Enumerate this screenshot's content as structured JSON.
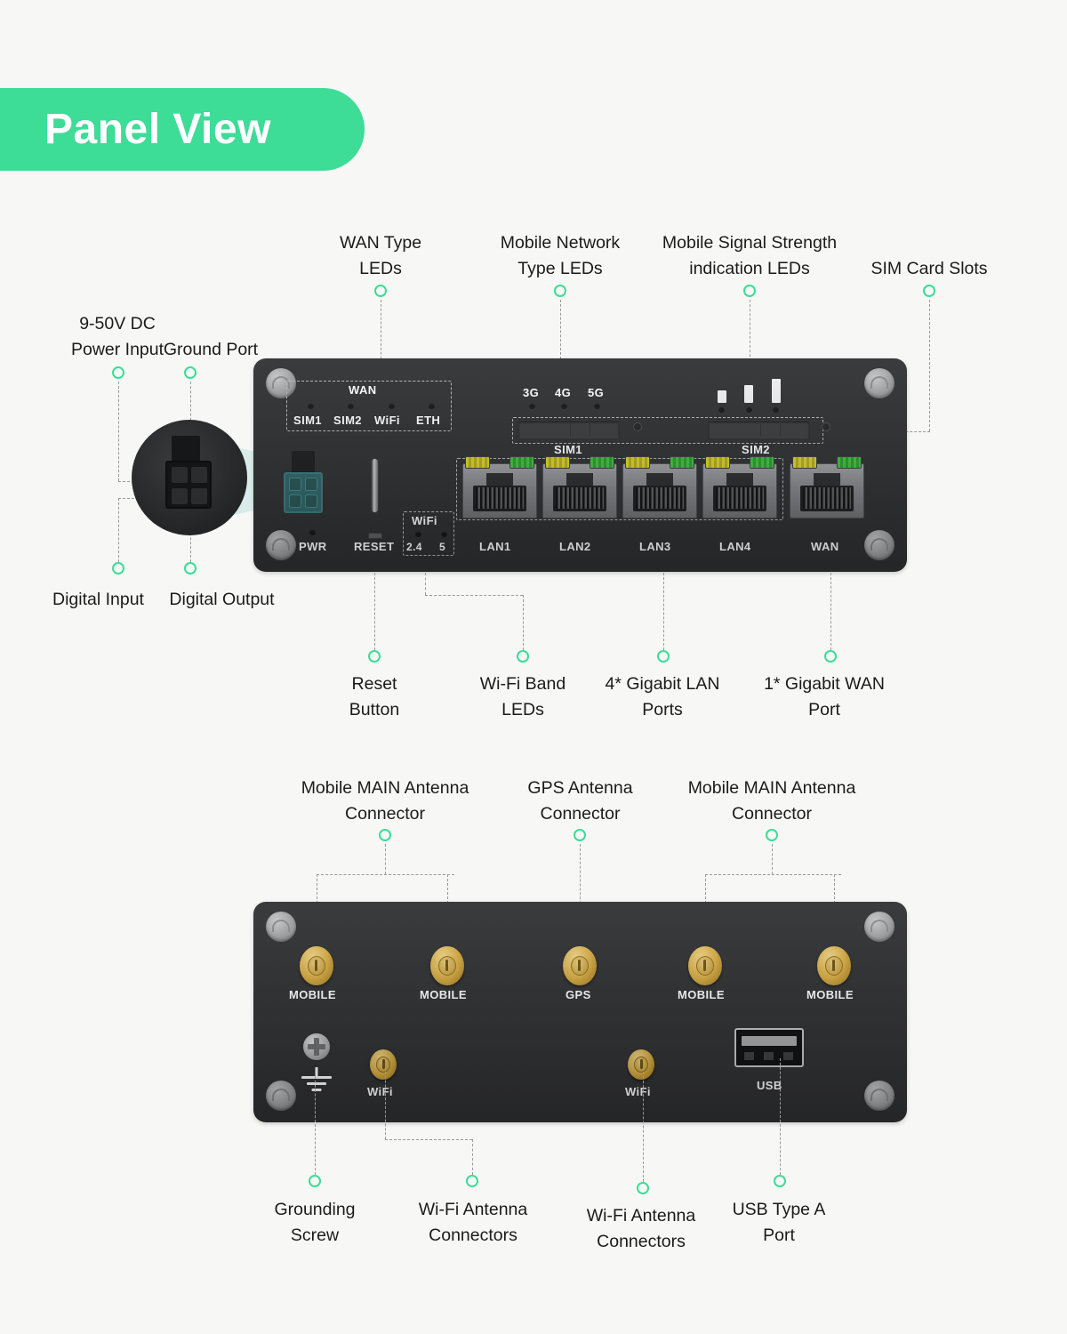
{
  "banner": {
    "title": "Panel View"
  },
  "front": {
    "callouts_top": [
      {
        "text": "WAN Type\nLEDs"
      },
      {
        "text": "Mobile Network\nType LEDs"
      },
      {
        "text": "Mobile Signal Strength\nindication LEDs"
      },
      {
        "text": "SIM Card Slots"
      }
    ],
    "callouts_left": [
      {
        "text": "9-50V DC\nPower Input"
      },
      {
        "text": "Ground Port"
      },
      {
        "text": "Digital Input"
      },
      {
        "text": "Digital Output"
      }
    ],
    "callouts_bottom": [
      {
        "text": "Reset\nButton"
      },
      {
        "text": "Wi-Fi Band\nLEDs"
      },
      {
        "text": "4* Gigabit LAN\nPorts"
      },
      {
        "text": "1* Gigabit WAN\nPort"
      }
    ],
    "wan_group": {
      "title": "WAN",
      "leds": [
        "SIM1",
        "SIM2",
        "WiFi",
        "ETH"
      ]
    },
    "network_leds": [
      "3G",
      "4G",
      "5G"
    ],
    "sim_labels": [
      "SIM1",
      "SIM2"
    ],
    "pwr_label": "PWR",
    "reset_label": "RESET",
    "wifi_group": {
      "title": "WiFi",
      "leds": [
        "2.4",
        "5"
      ]
    },
    "ports": [
      "LAN1",
      "LAN2",
      "LAN3",
      "LAN4",
      "WAN"
    ]
  },
  "rear": {
    "callouts_top": [
      {
        "text": "Mobile MAIN Antenna\nConnector"
      },
      {
        "text": "GPS Antenna\nConnector"
      },
      {
        "text": "Mobile MAIN Antenna\nConnector"
      }
    ],
    "callouts_bottom": [
      {
        "text": "Grounding\nScrew"
      },
      {
        "text": "Wi-Fi Antenna\nConnectors"
      },
      {
        "text": "Wi-Fi Antenna\nConnectors"
      },
      {
        "text": "USB Type A\nPort"
      }
    ],
    "antenna_labels": [
      "MOBILE",
      "MOBILE",
      "GPS",
      "MOBILE",
      "MOBILE"
    ],
    "wifi_labels": [
      "WiFi",
      "WiFi"
    ],
    "usb_label": "USB"
  },
  "colors": {
    "accent": "#3ddc97",
    "background": "#f7f7f6",
    "chassis": "#2f3032",
    "led_yellow": "#d9d12e",
    "led_green": "#3fc23f",
    "connector_gold": "#d6ab42",
    "connector_teal": "#3c8285"
  }
}
